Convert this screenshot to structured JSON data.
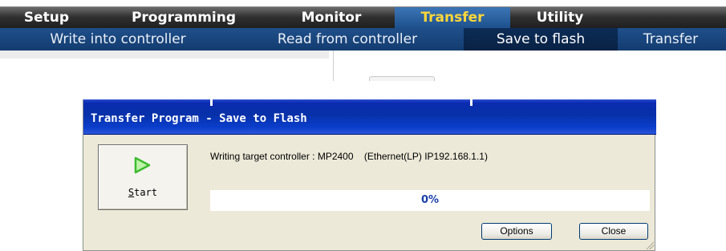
{
  "menu": {
    "tabs": [
      {
        "label": "Setup"
      },
      {
        "label": "Programming"
      },
      {
        "label": "Monitor"
      },
      {
        "label": "Transfer",
        "active": true
      },
      {
        "label": "Utility"
      }
    ],
    "subitems": [
      {
        "label": "Write into controller"
      },
      {
        "label": "Read from controller"
      },
      {
        "label": "Save to flash",
        "active": true
      },
      {
        "label": "Transfer"
      }
    ]
  },
  "dialog": {
    "title": "Transfer Program - Save to Flash",
    "start_label_rest": "tart",
    "start_label_mnemonic": "S",
    "info_text": "Writing target controller : MP2400    (Ethernet(LP) IP192.168.1.1)",
    "progress": {
      "percent": 0,
      "text": "0%"
    },
    "options_label": "Options",
    "close_label": "Close"
  },
  "colors": {
    "active_tab_text": "#ffd73a",
    "title_bar": "#0731a9",
    "dialog_bg": "#ece9d8",
    "progress_text": "#1b3fa8",
    "play_icon": "#3dbb2f"
  },
  "icons": {
    "start": "play-icon"
  }
}
